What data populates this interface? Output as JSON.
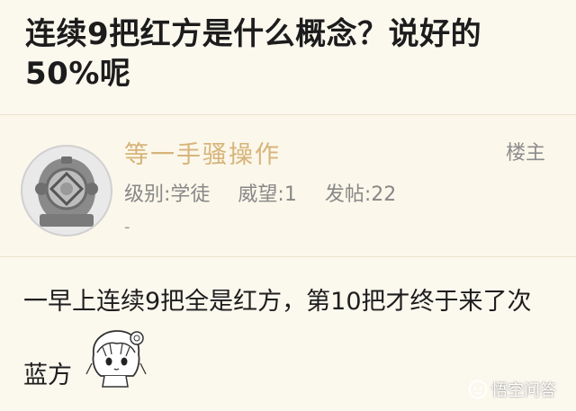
{
  "post": {
    "title": "连续9把红方是什么概念？说好的50%呢"
  },
  "author": {
    "name": "等一手骚操作",
    "rank": "级别:学徒",
    "prestige": "威望:1",
    "posts": "发帖:22",
    "dash": "-",
    "op_label": "楼主"
  },
  "body": {
    "line1": "一早上连续9把全是红方，第10把才终于来了次",
    "line2": "蓝方"
  },
  "watermark": {
    "text": "悟空问答"
  },
  "icons": {
    "avatar": "diving-helmet-avatar-icon",
    "sticker": "anime-girl-sticker-icon",
    "watermark": "wukong-logo-icon"
  }
}
